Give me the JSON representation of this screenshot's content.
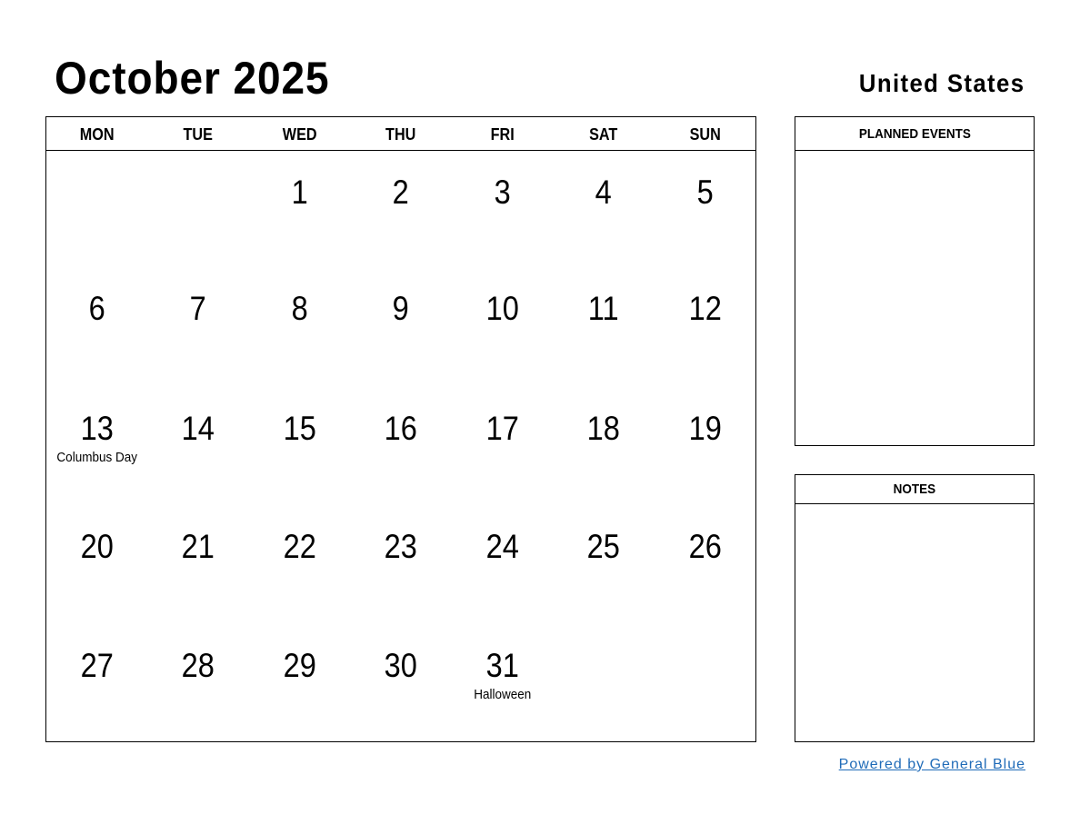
{
  "header": {
    "title": "October 2025",
    "country": "United States"
  },
  "calendar": {
    "weekdays": [
      "MON",
      "TUE",
      "WED",
      "THU",
      "FRI",
      "SAT",
      "SUN"
    ],
    "weeks": [
      [
        {
          "day": ""
        },
        {
          "day": ""
        },
        {
          "day": "1"
        },
        {
          "day": "2"
        },
        {
          "day": "3"
        },
        {
          "day": "4"
        },
        {
          "day": "5"
        }
      ],
      [
        {
          "day": "6"
        },
        {
          "day": "7"
        },
        {
          "day": "8"
        },
        {
          "day": "9"
        },
        {
          "day": "10"
        },
        {
          "day": "11"
        },
        {
          "day": "12"
        }
      ],
      [
        {
          "day": "13",
          "holiday": "Columbus Day"
        },
        {
          "day": "14"
        },
        {
          "day": "15"
        },
        {
          "day": "16"
        },
        {
          "day": "17"
        },
        {
          "day": "18"
        },
        {
          "day": "19"
        }
      ],
      [
        {
          "day": "20"
        },
        {
          "day": "21"
        },
        {
          "day": "22"
        },
        {
          "day": "23"
        },
        {
          "day": "24"
        },
        {
          "day": "25"
        },
        {
          "day": "26"
        }
      ],
      [
        {
          "day": "27"
        },
        {
          "day": "28"
        },
        {
          "day": "29"
        },
        {
          "day": "30"
        },
        {
          "day": "31",
          "holiday": "Halloween"
        },
        {
          "day": ""
        },
        {
          "day": ""
        }
      ]
    ]
  },
  "panels": {
    "planned_events": "PLANNED EVENTS",
    "notes": "NOTES"
  },
  "footer": {
    "powered_by": "Powered by General Blue",
    "link_color": "#1f6bb8"
  }
}
